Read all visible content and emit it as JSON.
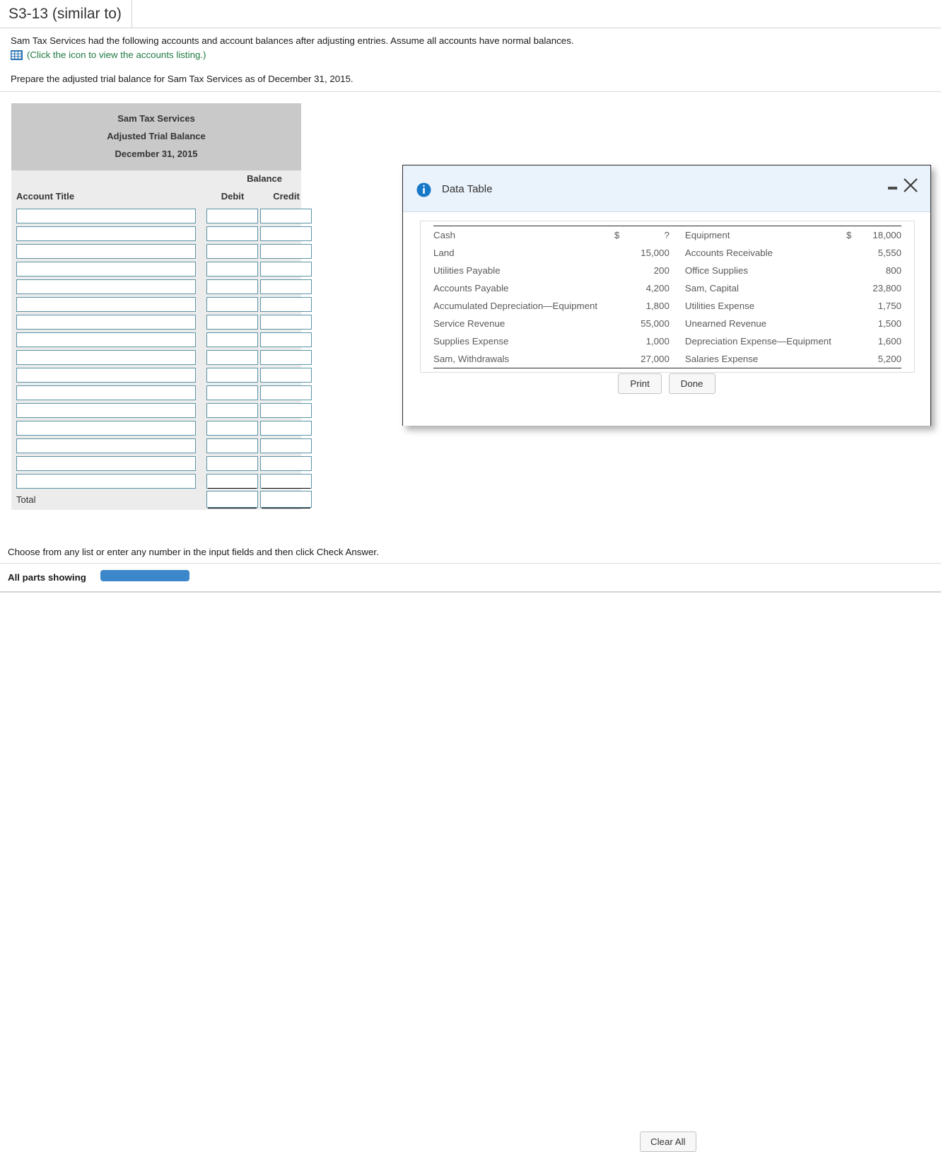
{
  "tab": {
    "label": "S3-13 (similar to)"
  },
  "problem": {
    "line1": "Sam Tax Services had the following accounts and account balances after adjusting entries. Assume all accounts have normal balances.",
    "icon_name": "table-grid-icon",
    "icon_link": "(Click the icon to view the accounts listing.)",
    "icon_link_color": "#1f7a43",
    "line3": "Prepare the adjusted trial balance for Sam Tax Services as of December 31, 2015."
  },
  "worksheet": {
    "title_line1": "Sam Tax Services",
    "title_line2": "Adjusted Trial Balance",
    "title_line3": "December 31, 2015",
    "balance_label": "Balance",
    "account_title_label": "Account Title",
    "debit_label": "Debit",
    "credit_label": "Credit",
    "total_label": "Total",
    "input_row_count": 16,
    "rows": [
      {
        "title": "",
        "debit": "",
        "credit": "",
        "rule": "none"
      },
      {
        "title": "",
        "debit": "",
        "credit": "",
        "rule": "none"
      },
      {
        "title": "",
        "debit": "",
        "credit": "",
        "rule": "none"
      },
      {
        "title": "",
        "debit": "",
        "credit": "",
        "rule": "none"
      },
      {
        "title": "",
        "debit": "",
        "credit": "",
        "rule": "none"
      },
      {
        "title": "",
        "debit": "",
        "credit": "",
        "rule": "none"
      },
      {
        "title": "",
        "debit": "",
        "credit": "",
        "rule": "none"
      },
      {
        "title": "",
        "debit": "",
        "credit": "",
        "rule": "none"
      },
      {
        "title": "",
        "debit": "",
        "credit": "",
        "rule": "none"
      },
      {
        "title": "",
        "debit": "",
        "credit": "",
        "rule": "none"
      },
      {
        "title": "",
        "debit": "",
        "credit": "",
        "rule": "none"
      },
      {
        "title": "",
        "debit": "",
        "credit": "",
        "rule": "none"
      },
      {
        "title": "",
        "debit": "",
        "credit": "",
        "rule": "none"
      },
      {
        "title": "",
        "debit": "",
        "credit": "",
        "rule": "none"
      },
      {
        "title": "",
        "debit": "",
        "credit": "",
        "rule": "none"
      },
      {
        "title": "",
        "debit": "",
        "credit": "",
        "rule": "single"
      }
    ],
    "total_row": {
      "debit": "",
      "credit": "",
      "rule": "double"
    }
  },
  "dialog": {
    "title": "Data Table",
    "info_icon_name": "info-icon",
    "minimize_icon_name": "minimize-icon",
    "close_icon_name": "close-icon",
    "accent_color": "#1878c8",
    "titlebar_bg": "#eaf2fb",
    "buttons": {
      "print": "Print",
      "done": "Done"
    },
    "table": {
      "rows": [
        {
          "left_name": "Cash",
          "left_cur": "$",
          "left_val": "?",
          "right_name": "Equipment",
          "right_cur": "$",
          "right_val": "18,000"
        },
        {
          "left_name": "Land",
          "left_cur": "",
          "left_val": "15,000",
          "right_name": "Accounts Receivable",
          "right_cur": "",
          "right_val": "5,550"
        },
        {
          "left_name": "Utilities Payable",
          "left_cur": "",
          "left_val": "200",
          "right_name": "Office Supplies",
          "right_cur": "",
          "right_val": "800"
        },
        {
          "left_name": "Accounts Payable",
          "left_cur": "",
          "left_val": "4,200",
          "right_name": "Sam, Capital",
          "right_cur": "",
          "right_val": "23,800"
        },
        {
          "left_name": "Accumulated Depreciation—Equipment",
          "left_cur": "",
          "left_val": "1,800",
          "right_name": "Utilities Expense",
          "right_cur": "",
          "right_val": "1,750"
        },
        {
          "left_name": "Service Revenue",
          "left_cur": "",
          "left_val": "55,000",
          "right_name": "Unearned Revenue",
          "right_cur": "",
          "right_val": "1,500"
        },
        {
          "left_name": "Supplies Expense",
          "left_cur": "",
          "left_val": "1,000",
          "right_name": "Depreciation Expense—Equipment",
          "right_cur": "",
          "right_val": "1,600"
        },
        {
          "left_name": "Sam, Withdrawals",
          "left_cur": "",
          "left_val": "27,000",
          "right_name": "Salaries Expense",
          "right_cur": "",
          "right_val": "5,200"
        }
      ]
    }
  },
  "footer": {
    "hint": "Choose from any list or enter any number in the input fields and then click Check Answer.",
    "parts_label": "All parts showing",
    "progress_color": "#3c87c9",
    "clear_all": "Clear All"
  }
}
